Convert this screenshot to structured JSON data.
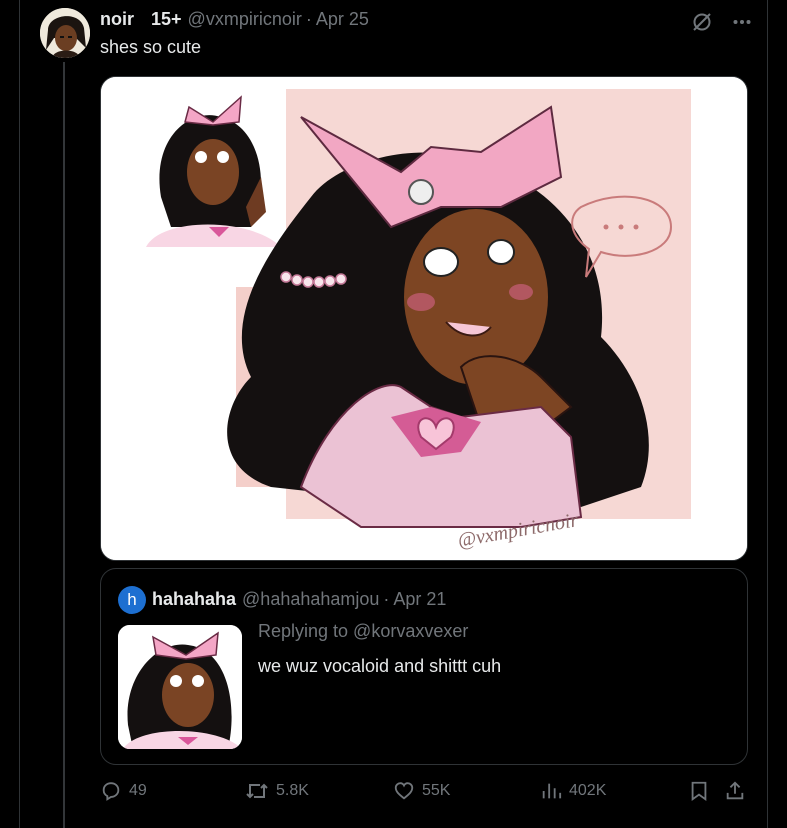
{
  "post": {
    "display_name": "noir",
    "badge": "15+",
    "handle": "@vxmpiricnoir",
    "date": "Apr 25",
    "text": "shes so cute",
    "image_watermark": "@vxmpiricnoir"
  },
  "quote": {
    "avatar_letter": "h",
    "display_name": "hahahaha",
    "handle": "@hahahahamjou",
    "date": "Apr 21",
    "replying_to": "Replying to @korvaxvexer",
    "text": "we wuz vocaloid and shittt cuh"
  },
  "actions": {
    "replies": "49",
    "reposts": "5.8K",
    "likes": "55K",
    "views": "402K"
  },
  "icons": [
    "grok-icon",
    "more-icon",
    "reply-icon",
    "repost-icon",
    "like-icon",
    "views-icon",
    "bookmark-icon",
    "share-icon"
  ],
  "colors": {
    "background": "#000000",
    "text": "#e7e9ea",
    "muted": "#71767b",
    "border": "#2f3336",
    "quote_avatar": "#1d6fd1",
    "art_pink": "#f2a7c3"
  }
}
